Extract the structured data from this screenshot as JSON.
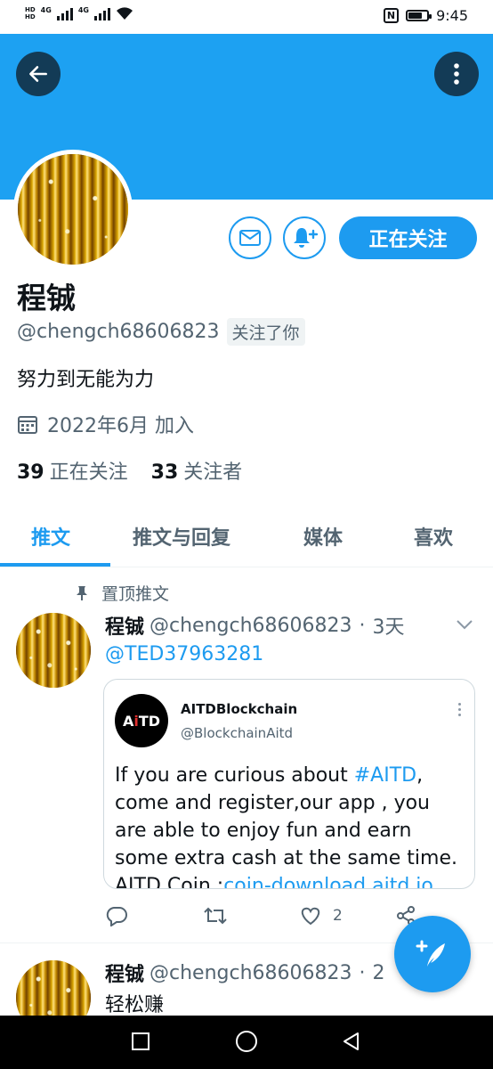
{
  "status_bar": {
    "network_left": "HD",
    "network_right": "HD",
    "sim1": "4G",
    "sim2": "4G",
    "nfc_label": "N",
    "time": "9:45",
    "battery_level": 0.75
  },
  "profile": {
    "name": "程铖",
    "handle": "@chengch68606823",
    "follows_you": "关注了你",
    "bio": "努力到无能为力",
    "joined": "2022年6月 加入",
    "following_count": "39",
    "following_label": "正在关注",
    "followers_count": "33",
    "followers_label": "关注者",
    "follow_button": "正在关注"
  },
  "tabs": [
    "推文",
    "推文与回复",
    "媒体",
    "喜欢"
  ],
  "pinned": {
    "label": "置顶推文",
    "author_name": "程铖",
    "author_handle": "@chengch68606823",
    "separator": "·",
    "time": "3天",
    "mention": "@TED37963281",
    "quote": {
      "avatar_text_a": "A",
      "avatar_text_b": "i",
      "avatar_text_c": "TD",
      "name": "AITDBlockchain",
      "handle": "@BlockchainAitd",
      "text_1": "If you are curious about ",
      "hashtag": "#AITD",
      "text_2": ", come and register,our app , you are able to enjoy fun and earn some extra cash at the same time.",
      "text_3": "AITD Coin :",
      "link": "coin-download.aitd.io"
    },
    "like_count": "2"
  },
  "second_tweet": {
    "author_name": "程铖",
    "author_handle": "@chengch68606823",
    "separator": "·",
    "time": "2",
    "text": "轻松赚"
  },
  "colors": {
    "accent": "#1d9bf0",
    "banner": "#1da1f2",
    "secondary_text": "#536471"
  }
}
